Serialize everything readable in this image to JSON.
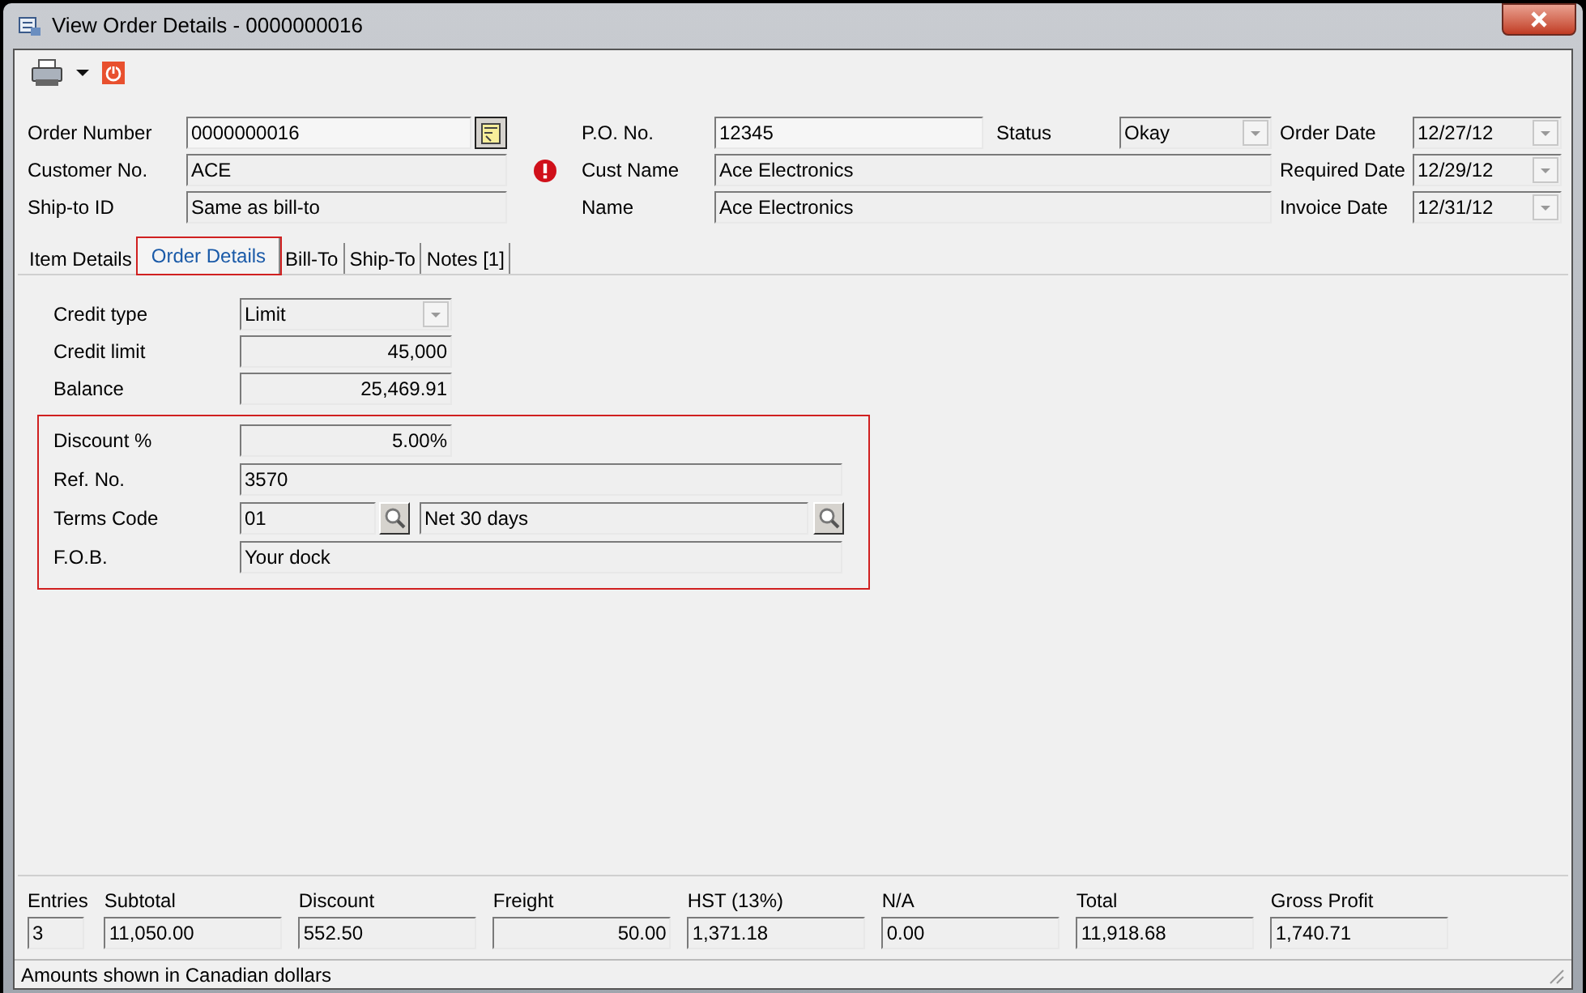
{
  "window": {
    "title": "View Order Details - 0000000016"
  },
  "header": {
    "order_number": {
      "label": "Order Number",
      "value": "0000000016"
    },
    "customer_no": {
      "label": "Customer No.",
      "value": "ACE",
      "warning": true
    },
    "ship_to_id": {
      "label": "Ship-to ID",
      "value": "Same as bill-to"
    },
    "po_no": {
      "label": "P.O. No.",
      "value": "12345"
    },
    "cust_name": {
      "label": "Cust Name",
      "value": "Ace Electronics"
    },
    "name": {
      "label": "Name",
      "value": "Ace Electronics"
    },
    "status": {
      "label": "Status",
      "value": "Okay"
    },
    "dates": [
      {
        "label": "Order Date",
        "value": "12/27/12"
      },
      {
        "label": "Required Date",
        "value": "12/29/12"
      },
      {
        "label": "Invoice Date",
        "value": "12/31/12"
      }
    ]
  },
  "tabs": [
    {
      "label": "Item Details",
      "selected": false,
      "highlighted": false
    },
    {
      "label": "Order Details",
      "selected": true,
      "highlighted": true
    },
    {
      "label": "Bill-To",
      "selected": false,
      "highlighted": false
    },
    {
      "label": "Ship-To",
      "selected": false,
      "highlighted": false
    },
    {
      "label": "Notes [1]",
      "selected": false,
      "highlighted": false
    }
  ],
  "credit": [
    {
      "kind": "combo",
      "label": "Credit type",
      "value": "Limit"
    },
    {
      "kind": "number",
      "label": "Credit limit",
      "value": "45,000"
    },
    {
      "kind": "number",
      "label": "Balance",
      "value": "25,469.91"
    }
  ],
  "terms_group": {
    "highlighted": true,
    "discount": {
      "label": "Discount %",
      "value": "5.00%"
    },
    "ref_no": {
      "label": "Ref. No.",
      "value": "3570"
    },
    "terms_code": {
      "label": "Terms Code",
      "code": "01",
      "description": "Net 30 days"
    },
    "fob": {
      "label": "F.O.B.",
      "value": "Your dock"
    }
  },
  "totals": [
    {
      "label": "Entries",
      "value": "3",
      "kind": "display"
    },
    {
      "label": "Subtotal",
      "value": "11,050.00",
      "kind": "display"
    },
    {
      "label": "Discount",
      "value": "552.50",
      "kind": "display"
    },
    {
      "label": "Freight",
      "value": "50.00",
      "kind": "input"
    },
    {
      "label": "HST (13%)",
      "value": "1,371.18",
      "kind": "display"
    },
    {
      "label": "N/A",
      "value": "0.00",
      "kind": "display"
    },
    {
      "label": "Total",
      "value": "11,918.68",
      "kind": "display"
    },
    {
      "label": "Gross Profit",
      "value": "1,740.71",
      "kind": "display"
    }
  ],
  "status_bar": "Amounts shown in Canadian dollars"
}
